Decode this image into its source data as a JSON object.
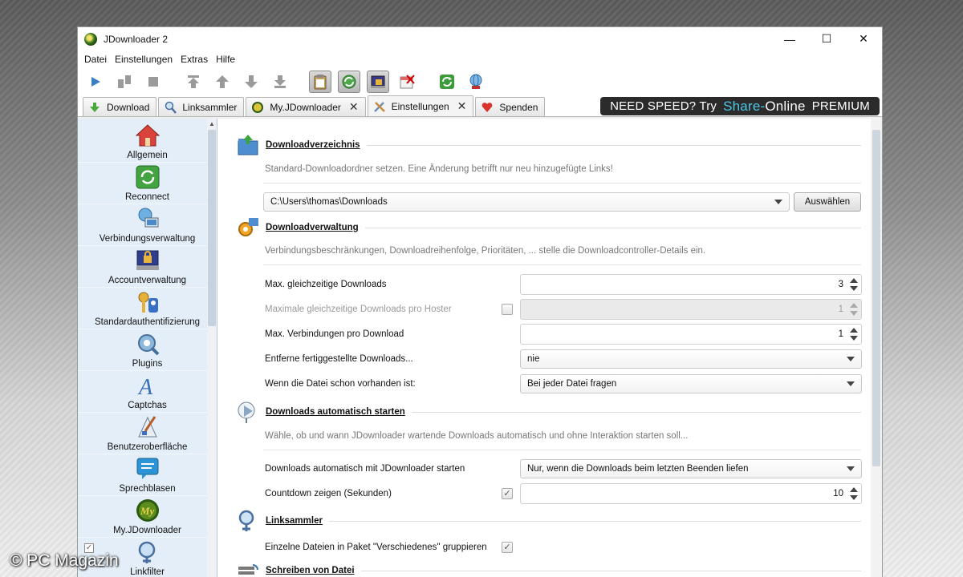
{
  "window": {
    "title": "JDownloader 2"
  },
  "window_controls": {
    "minimize": "—",
    "maximize": "☐",
    "close": "✕"
  },
  "menu": [
    "Datei",
    "Einstellungen",
    "Extras",
    "Hilfe"
  ],
  "tabs": [
    {
      "label": "Download",
      "icon": "download-arrow-icon",
      "closable": false
    },
    {
      "label": "Linksammler",
      "icon": "magnifier-icon",
      "closable": false
    },
    {
      "label": "My.JDownloader",
      "icon": "myjd-icon",
      "closable": true
    },
    {
      "label": "Einstellungen",
      "icon": "tools-icon",
      "closable": true,
      "active": true
    },
    {
      "label": "Spenden",
      "icon": "heart-icon",
      "closable": false
    }
  ],
  "banner": {
    "prefix": "NEED SPEED? Try",
    "brand_a": "Share-",
    "brand_b": "Online",
    "suffix": "PREMIUM"
  },
  "sidebar": {
    "items": [
      {
        "label": "Allgemein",
        "icon": "house-icon"
      },
      {
        "label": "Reconnect",
        "icon": "reconnect-icon"
      },
      {
        "label": "Verbindungsverwaltung",
        "icon": "network-icon"
      },
      {
        "label": "Accountverwaltung",
        "icon": "account-lock-icon"
      },
      {
        "label": "Standardauthentifizierung",
        "icon": "keys-icon"
      },
      {
        "label": "Plugins",
        "icon": "plugin-gear-icon"
      },
      {
        "label": "Captchas",
        "icon": "captcha-icon"
      },
      {
        "label": "Benutzeroberfläche",
        "icon": "brush-icon"
      },
      {
        "label": "Sprechblasen",
        "icon": "speech-bubble-icon"
      },
      {
        "label": "My.JDownloader",
        "icon": "myjd-icon"
      },
      {
        "label": "Linkfilter",
        "icon": "linkfilter-icon"
      }
    ]
  },
  "settings": {
    "downloadverzeichnis": {
      "title": "Downloadverzeichnis",
      "description": "Standard-Downloadordner setzen. Eine Änderung betrifft nur neu hinzugefügte Links!",
      "path": "C:\\Users\\thomas\\Downloads",
      "choose_button": "Auswählen"
    },
    "downloadverwaltung": {
      "title": "Downloadverwaltung",
      "description": "Verbindungsbeschränkungen, Downloadreihenfolge, Prioritäten, ... stelle die Downloadcontroller-Details ein.",
      "max_downloads_label": "Max. gleichzeitige Downloads",
      "max_downloads_value": "3",
      "max_per_hoster_label": "Maximale gleichzeitige Downloads pro Hoster",
      "max_per_hoster_value": "1",
      "max_connections_label": "Max. Verbindungen pro Download",
      "max_connections_value": "1",
      "remove_finished_label": "Entferne fertiggestellte Downloads...",
      "remove_finished_value": "nie",
      "file_exists_label": "Wenn die Datei schon vorhanden ist:",
      "file_exists_value": "Bei jeder Datei fragen"
    },
    "autostart": {
      "title": "Downloads automatisch starten",
      "description": "Wähle, ob und wann JDownloader wartende Downloads automatisch und ohne Interaktion starten soll...",
      "autostart_label": "Downloads automatisch mit JDownloader starten",
      "autostart_value": "Nur, wenn die Downloads beim letzten Beenden liefen",
      "countdown_label": "Countdown zeigen (Sekunden)",
      "countdown_value": "10"
    },
    "linksammler": {
      "title": "Linksammler",
      "group_label": "Einzelne Dateien in Paket \"Verschiedenes\" gruppieren"
    },
    "schreiben": {
      "title": "Schreiben von Datei"
    }
  },
  "watermark": "© PC Magazin"
}
